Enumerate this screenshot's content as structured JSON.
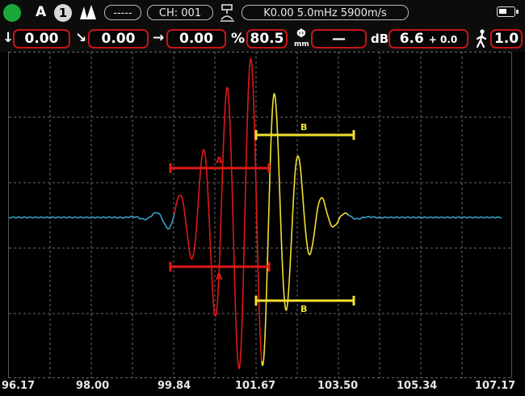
{
  "status": {
    "gate_label": "A",
    "channel_badge": "1",
    "mode_pill": "-----",
    "channel": "CH: 001",
    "probe_info": "K0.00  5.0mHz  5900m/s"
  },
  "readouts": {
    "depth": "0.00",
    "surface": "0.00",
    "horizontal": "0.00",
    "percent_symbol": "%",
    "amplitude": "80.5",
    "phi_symbol": "Φ",
    "phi_unit": "mm",
    "diameter": "—",
    "db_symbol": "dB",
    "gain": "6.6",
    "gain_offset": "+ 0.0",
    "step": "1.0"
  },
  "gates": {
    "a_label": "A",
    "b_label": "B"
  },
  "x_axis": {
    "ticks": [
      "96.17",
      "98.00",
      "99.84",
      "101.67",
      "103.50",
      "105.34",
      "107.17"
    ]
  },
  "colors": {
    "waveform": "#3aa0c8",
    "gate_a": "#e01818",
    "gate_b": "#f0e030",
    "status_ok": "#1aa83a",
    "border": "#c81414"
  },
  "icons": [
    "status-light-icon",
    "peak-icon",
    "probe-icon",
    "battery-icon",
    "arrow-down-icon",
    "arrow-diagonal-icon",
    "arrow-right-icon",
    "walker-icon"
  ]
}
